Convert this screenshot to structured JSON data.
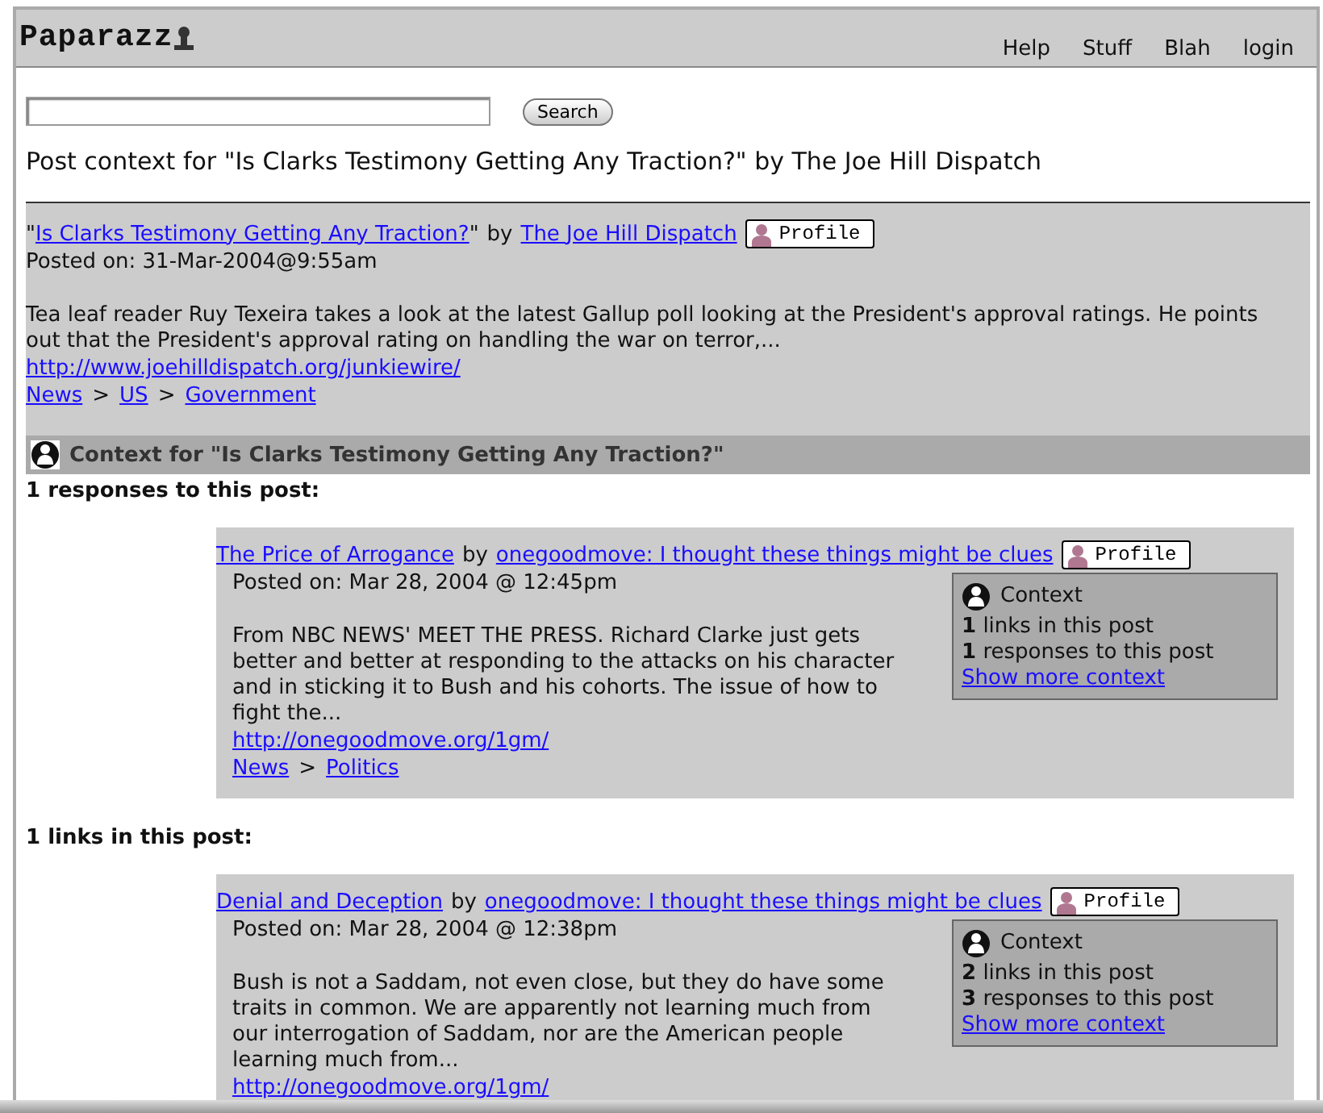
{
  "header": {
    "logo": "Paparazz",
    "nav": [
      "Help",
      "Stuff",
      "Blah",
      "login"
    ]
  },
  "search": {
    "button": "Search"
  },
  "page_title": "Post context for \"Is Clarks Testimony Getting Any Traction?\" by The Joe Hill Dispatch",
  "post": {
    "quote_open": "\"",
    "title": "Is Clarks Testimony Getting Any Traction?",
    "quote_close": "\"",
    "by": "by",
    "author": "The Joe Hill Dispatch",
    "profile": "Profile",
    "posted": "Posted on: 31-Mar-2004@9:55am",
    "summary": "Tea leaf reader Ruy Texeira takes a look at the latest Gallup poll looking at the President's approval ratings. He points out that the President's approval rating on handling the war on terror,...",
    "url": "http://www.joehilldispatch.org/junkiewire/",
    "breadcrumbs": [
      "News",
      "US",
      "Government"
    ],
    "separator": ">"
  },
  "context_heading": "Context for \"Is Clarks Testimony Getting Any Traction?\"",
  "sections": [
    {
      "heading": "1 responses to this post:",
      "items": [
        {
          "title": "The Price of Arrogance",
          "by": "by",
          "author": "onegoodmove: I thought these things might be clues",
          "profile": "Profile",
          "posted": "Posted on: Mar 28, 2004 @ 12:45pm",
          "summary": "From NBC NEWS' MEET THE PRESS. Richard Clarke just gets better and better at responding to the attacks on his character and in sticking it to Bush and his cohorts. The issue of how to fight the...",
          "url": "http://onegoodmove.org/1gm/",
          "breadcrumbs": [
            "News",
            "Politics"
          ],
          "separator": ">",
          "context": {
            "title": "Context",
            "links_count": "1",
            "links_label": "links in this post",
            "responses_count": "1",
            "responses_label": "responses to this post",
            "more": "Show more context"
          }
        }
      ]
    },
    {
      "heading": "1 links in this post:",
      "items": [
        {
          "title": "Denial and Deception",
          "by": "by",
          "author": "onegoodmove: I thought these things might be clues",
          "profile": "Profile",
          "posted": "Posted on: Mar 28, 2004 @ 12:38pm",
          "summary": "Bush is not a Saddam, not even close, but they do have some traits in common. We are apparently not learning much from our interrogation of Saddam, nor are the American people learning much from...",
          "url": "http://onegoodmove.org/1gm/",
          "context": {
            "title": "Context",
            "links_count": "2",
            "links_label": "links in this post",
            "responses_count": "3",
            "responses_label": "responses to this post",
            "more": "Show more context"
          }
        }
      ]
    }
  ]
}
